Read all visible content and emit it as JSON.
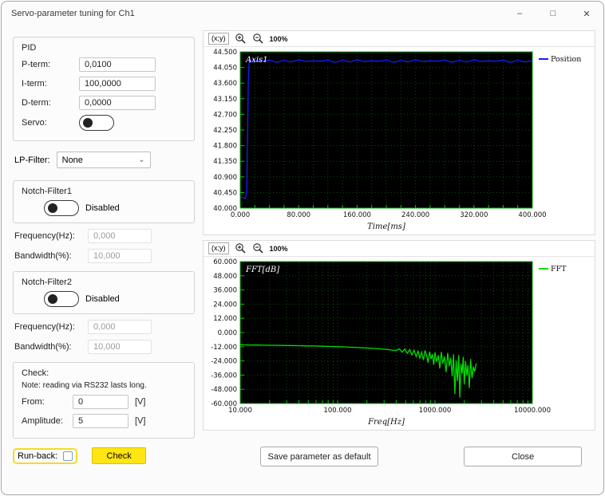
{
  "window": {
    "title": "Servo-parameter tuning for Ch1",
    "minimize": "–",
    "maximize": "□",
    "close": "✕"
  },
  "pid": {
    "label": "PID",
    "p_label": "P-term:",
    "p_value": "0,0100",
    "i_label": "I-term:",
    "i_value": "100,0000",
    "d_label": "D-term:",
    "d_value": "0,0000",
    "servo_label": "Servo:"
  },
  "lp_filter": {
    "label": "LP-Filter:",
    "value": "None"
  },
  "notch1": {
    "label": "Notch-Filter1",
    "state": "Disabled",
    "freq_label": "Frequency(Hz):",
    "freq_value": "0,000",
    "bw_label": "Bandwidth(%):",
    "bw_value": "10,000"
  },
  "notch2": {
    "label": "Notch-Filter2",
    "state": "Disabled",
    "freq_label": "Frequency(Hz):",
    "freq_value": "0,000",
    "bw_label": "Bandwidth(%):",
    "bw_value": "10,000"
  },
  "check": {
    "label": "Check:",
    "note": "Note: reading via RS232 lasts long.",
    "from_label": "From:",
    "from_value": "0",
    "from_unit": "[V]",
    "amp_label": "Amplitude:",
    "amp_value": "5",
    "amp_unit": "[V]",
    "runback_label": "Run-back:",
    "check_button": "Check"
  },
  "chart_toolbar": {
    "xy": "(x;y)",
    "zoom": "100%"
  },
  "footer": {
    "save_button": "Save parameter as default",
    "close_button": "Close"
  },
  "chart_data": [
    {
      "type": "line",
      "title": "Axis1",
      "xlabel": "Time[ms]",
      "legend": "Position",
      "color": "#1b1bff",
      "xscale": "linear",
      "xlim": [
        0,
        400
      ],
      "ylim": [
        40.0,
        44.5
      ],
      "yticks": [
        44.5,
        44.05,
        43.6,
        43.15,
        42.7,
        42.25,
        41.8,
        41.35,
        40.9,
        40.45,
        40.0
      ],
      "ytick_labels": [
        "44.500",
        "44.050",
        "43.600",
        "43.150",
        "42.700",
        "42.250",
        "41.800",
        "41.350",
        "40.900",
        "40.450",
        "40.000"
      ],
      "xticks": [
        0,
        80,
        160,
        240,
        320,
        400
      ],
      "xtick_labels": [
        "0.000",
        "80.000",
        "160.000",
        "240.000",
        "320.000",
        "400.000"
      ],
      "minor_x_step": 20,
      "grid": true,
      "legend_position": "top-right",
      "points": [
        [
          0,
          40.32
        ],
        [
          4,
          40.3
        ],
        [
          7,
          40.28
        ],
        [
          9,
          40.5
        ],
        [
          10,
          42.0
        ],
        [
          11,
          43.6
        ],
        [
          12,
          44.12
        ],
        [
          13,
          44.3
        ],
        [
          14,
          44.2
        ],
        [
          16,
          44.27
        ],
        [
          18,
          44.2
        ],
        [
          20,
          44.25
        ],
        [
          30,
          44.23
        ],
        [
          40,
          44.26
        ],
        [
          50,
          44.2
        ],
        [
          60,
          44.25
        ],
        [
          70,
          44.21
        ],
        [
          80,
          44.27
        ],
        [
          90,
          44.22
        ],
        [
          100,
          44.24
        ],
        [
          110,
          44.23
        ],
        [
          120,
          44.26
        ],
        [
          130,
          44.2
        ],
        [
          140,
          44.25
        ],
        [
          150,
          44.21
        ],
        [
          160,
          44.27
        ],
        [
          170,
          44.22
        ],
        [
          180,
          44.24
        ],
        [
          190,
          44.23
        ],
        [
          200,
          44.26
        ],
        [
          210,
          44.2
        ],
        [
          220,
          44.25
        ],
        [
          230,
          44.21
        ],
        [
          240,
          44.27
        ],
        [
          250,
          44.22
        ],
        [
          260,
          44.24
        ],
        [
          270,
          44.23
        ],
        [
          280,
          44.26
        ],
        [
          290,
          44.2
        ],
        [
          300,
          44.25
        ],
        [
          310,
          44.21
        ],
        [
          320,
          44.27
        ],
        [
          330,
          44.22
        ],
        [
          340,
          44.24
        ],
        [
          350,
          44.23
        ],
        [
          360,
          44.26
        ],
        [
          370,
          44.2
        ],
        [
          380,
          44.25
        ],
        [
          390,
          44.21
        ],
        [
          400,
          44.24
        ]
      ]
    },
    {
      "type": "line",
      "title": "FFT[dB]",
      "xlabel": "Freq[Hz]",
      "legend": "FFT",
      "color": "#00dd00",
      "xscale": "log",
      "xlim": [
        10,
        10000
      ],
      "ylim": [
        -60,
        60
      ],
      "yticks": [
        60,
        48,
        36,
        24,
        12,
        0,
        -12,
        -24,
        -36,
        -48,
        -60
      ],
      "ytick_labels": [
        "60.000",
        "48.000",
        "36.000",
        "24.000",
        "12.000",
        "0.000",
        "-12.000",
        "-24.000",
        "-36.000",
        "-48.000",
        "-60.000"
      ],
      "xticks": [
        10,
        100,
        1000,
        10000
      ],
      "xtick_labels": [
        "10.000",
        "100.000",
        "1000.000",
        "10000.000"
      ],
      "grid": true,
      "legend_position": "top-right",
      "points": [
        [
          10,
          -10.4
        ],
        [
          12,
          -10.5
        ],
        [
          15,
          -10.6
        ],
        [
          18,
          -10.7
        ],
        [
          22,
          -10.8
        ],
        [
          27,
          -10.9
        ],
        [
          33,
          -11.0
        ],
        [
          40,
          -11.1
        ],
        [
          48,
          -11.3
        ],
        [
          58,
          -11.4
        ],
        [
          70,
          -11.6
        ],
        [
          85,
          -11.8
        ],
        [
          100,
          -12.0
        ],
        [
          120,
          -12.2
        ],
        [
          140,
          -12.5
        ],
        [
          170,
          -12.8
        ],
        [
          200,
          -13.1
        ],
        [
          240,
          -13.5
        ],
        [
          280,
          -13.9
        ],
        [
          320,
          -14.3
        ],
        [
          360,
          -14.8
        ],
        [
          400,
          -15.3
        ],
        [
          430,
          -13.8
        ],
        [
          460,
          -16.6
        ],
        [
          490,
          -13.9
        ],
        [
          520,
          -17.6
        ],
        [
          550,
          -14.4
        ],
        [
          580,
          -18.8
        ],
        [
          610,
          -15.0
        ],
        [
          640,
          -20.2
        ],
        [
          670,
          -15.8
        ],
        [
          700,
          -21.6
        ],
        [
          730,
          -16.6
        ],
        [
          760,
          -23.2
        ],
        [
          790,
          -15.2
        ],
        [
          820,
          -19.4
        ],
        [
          850,
          -25.4
        ],
        [
          880,
          -16.2
        ],
        [
          910,
          -22.4
        ],
        [
          940,
          -18.2
        ],
        [
          970,
          -27.2
        ],
        [
          1000,
          -16.8
        ],
        [
          1040,
          -24.6
        ],
        [
          1080,
          -19.2
        ],
        [
          1120,
          -30.4
        ],
        [
          1160,
          -16.4
        ],
        [
          1200,
          -26.2
        ],
        [
          1250,
          -20.2
        ],
        [
          1300,
          -33.4
        ],
        [
          1350,
          -17.2
        ],
        [
          1400,
          -28.6
        ],
        [
          1450,
          -21.4
        ],
        [
          1500,
          -37.0
        ],
        [
          1550,
          -18.4
        ],
        [
          1600,
          -52.0
        ],
        [
          1650,
          -23.6
        ],
        [
          1700,
          -41.0
        ],
        [
          1750,
          -19.0
        ],
        [
          1800,
          -55.0
        ],
        [
          1850,
          -26.4
        ],
        [
          1900,
          -34.8
        ],
        [
          1950,
          -20.6
        ],
        [
          2000,
          -44.0
        ],
        [
          2060,
          -24.2
        ],
        [
          2120,
          -36.4
        ],
        [
          2180,
          -27.6
        ],
        [
          2250,
          -47.0
        ],
        [
          2320,
          -22.4
        ],
        [
          2400,
          -38.6
        ],
        [
          2480,
          -28.8
        ],
        [
          2560,
          -33.2
        ],
        [
          2650,
          -26.0
        ]
      ]
    }
  ]
}
